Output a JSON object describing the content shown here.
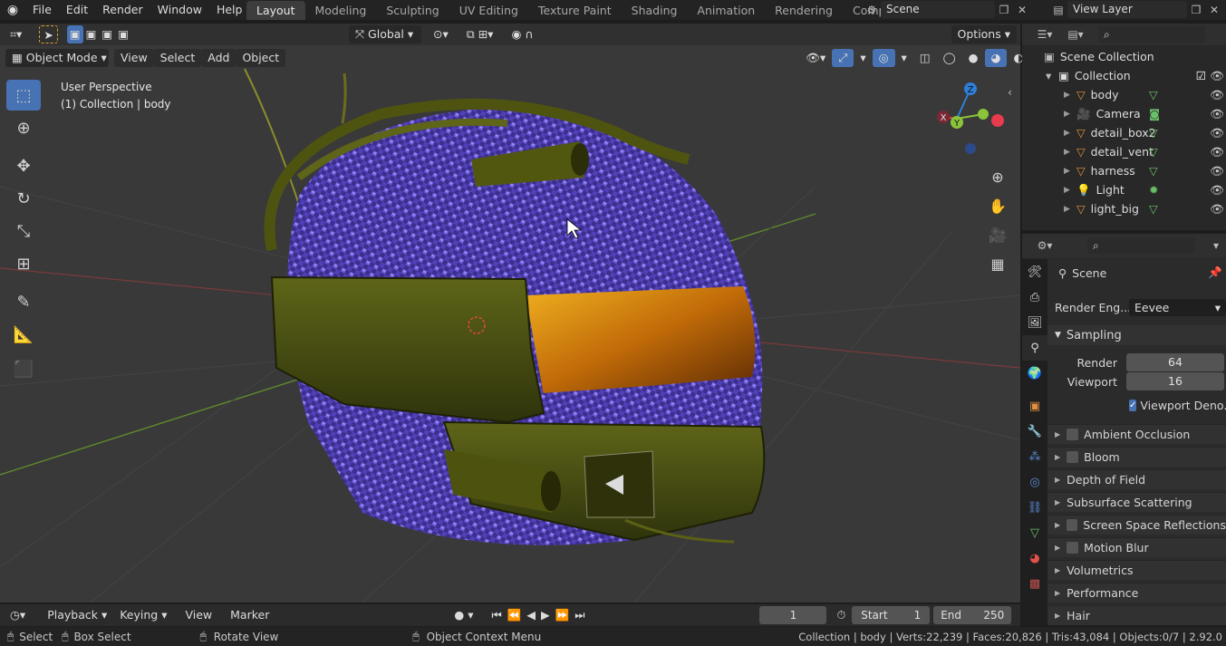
{
  "topbar": {
    "menus": [
      "File",
      "Edit",
      "Render",
      "Window",
      "Help"
    ],
    "workspaces": [
      "Layout",
      "Modeling",
      "Sculpting",
      "UV Editing",
      "Texture Paint",
      "Shading",
      "Animation",
      "Rendering",
      "Compositin"
    ],
    "active_workspace": "Layout",
    "scene": "Scene",
    "view_layer": "View Layer"
  },
  "viewport_header": {
    "orientation": "Global",
    "options_label": "Options",
    "mode": "Object Mode",
    "menus": [
      "View",
      "Select",
      "Add",
      "Object"
    ]
  },
  "viewport": {
    "line1": "User Perspective",
    "line2": "(1) Collection | body",
    "gizmo": {
      "z": "Z",
      "y": "Y",
      "x": "X"
    }
  },
  "outliner": {
    "root": "Scene Collection",
    "collection": "Collection",
    "items": [
      {
        "label": "body",
        "icon": "mesh-icon"
      },
      {
        "label": "Camera",
        "icon": "camera-icon"
      },
      {
        "label": "detail_box2",
        "icon": "mesh-icon"
      },
      {
        "label": "detail_vent",
        "icon": "mesh-icon"
      },
      {
        "label": "harness",
        "icon": "mesh-icon"
      },
      {
        "label": "Light",
        "icon": "light-icon"
      },
      {
        "label": "light_big",
        "icon": "mesh-icon"
      }
    ]
  },
  "properties": {
    "context": "Scene",
    "render_engine_label": "Render Eng...",
    "render_engine": "Eevee",
    "sampling_label": "Sampling",
    "render_label": "Render",
    "render_samples": "64",
    "viewport_label": "Viewport",
    "viewport_samples": "16",
    "viewport_denoise": "Viewport Deno...",
    "panels": [
      {
        "label": "Ambient Occlusion",
        "checkbox": true
      },
      {
        "label": "Bloom",
        "checkbox": true
      },
      {
        "label": "Depth of Field",
        "checkbox": false
      },
      {
        "label": "Subsurface Scattering",
        "checkbox": false
      },
      {
        "label": "Screen Space Reflections",
        "checkbox": true
      },
      {
        "label": "Motion Blur",
        "checkbox": true
      },
      {
        "label": "Volumetrics",
        "checkbox": false
      },
      {
        "label": "Performance",
        "checkbox": false
      },
      {
        "label": "Hair",
        "checkbox": false
      }
    ]
  },
  "timeline": {
    "playback": "Playback",
    "keying": "Keying",
    "view": "View",
    "marker": "Marker",
    "current_frame": "1",
    "start_label": "Start",
    "start": "1",
    "end_label": "End",
    "end": "250"
  },
  "statusbar": {
    "select": "Select",
    "box_select": "Box Select",
    "rotate": "Rotate View",
    "context_menu": "Object Context Menu",
    "stats": "Collection | body | Verts:22,239 | Faces:20,826 | Tris:43,084 | Objects:0/7 | 2.92.0"
  },
  "colors": {
    "accent": "#4772b3",
    "x_axis": "#e83b4e",
    "y_axis": "#8bc43a",
    "z_axis": "#2f7fd8"
  }
}
